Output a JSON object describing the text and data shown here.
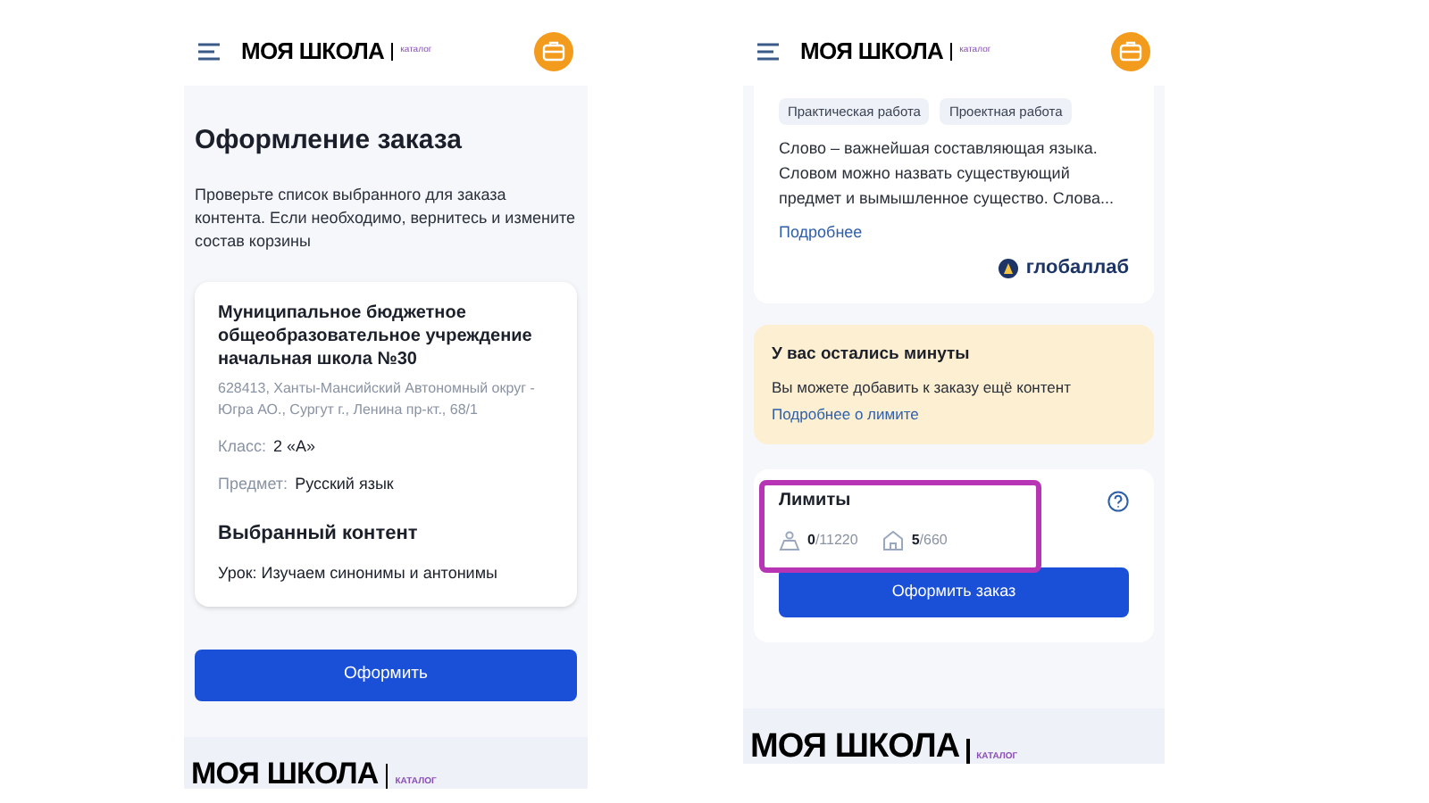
{
  "order_screen": {
    "header": {
      "logo": "МОЯ ШКОЛА",
      "logo_tag": "каталог"
    },
    "title": "Оформление заказа",
    "description": "Проверьте список выбранного для заказа контента. Если необходимо, вернитесь и измените состав корзины",
    "card": {
      "school": "Муниципальное бюджетное общеобразовательное учреждение начальная школа №30",
      "address": "628413, Ханты-Мансийский Автономный округ - Югра АО., Сургут г., Ленина пр-кт., 68/1",
      "fields": [
        {
          "label": "Класс:",
          "value": "2 «А»"
        },
        {
          "label": "Предмет:",
          "value": "Русский язык"
        }
      ],
      "content_title": "Выбранный контент",
      "content_item": "Урок: Изучаем синонимы и антонимы"
    },
    "button": "Оформить",
    "footer": {
      "logo": "МОЯ ШКОЛА",
      "logo_tag": "КАТАЛОГ"
    }
  },
  "limits_screen": {
    "header": {
      "logo": "МОЯ ШКОЛА",
      "logo_tag": "каталог"
    },
    "tags": [
      "Практическая работа",
      "Проектная работа"
    ],
    "text": "Слово – важнейшая составляющая языка. Словом можно назвать существующий предмет и вымышленное существо. Слова...",
    "more_link": "Подробнее",
    "provider": "глобаллаб",
    "notice": {
      "title": "У вас остались минуты",
      "text": "Вы можете добавить к заказу ещё контент",
      "link": "Подробнее о лимите"
    },
    "limits": {
      "title": "Лимиты",
      "highlighted": true,
      "counters": [
        {
          "kind": "users",
          "used": "0",
          "total": "/11220"
        },
        {
          "kind": "school",
          "used": "5",
          "total": "/660"
        }
      ]
    },
    "button": "Оформить заказ",
    "footer": {
      "logo": "МОЯ ШКОЛА",
      "logo_tag": "КАТАЛОГ"
    }
  }
}
